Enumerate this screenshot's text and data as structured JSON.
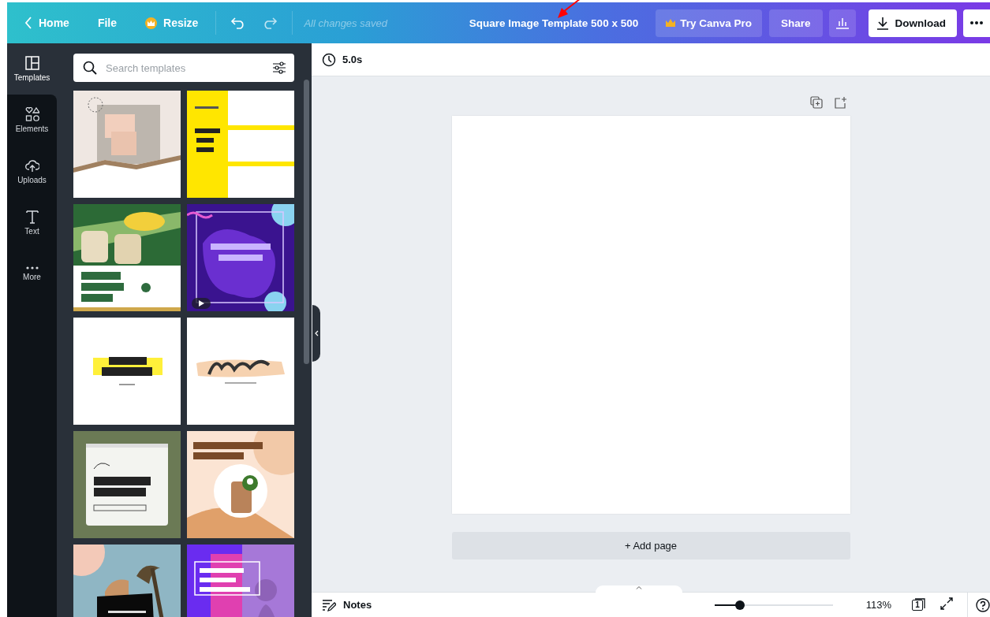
{
  "topbar": {
    "home": "Home",
    "file": "File",
    "resize": "Resize",
    "save_status": "All changes saved",
    "title": "Square Image Template 500 x 500",
    "pro_button": "Try Canva Pro",
    "share": "Share",
    "download": "Download"
  },
  "rail": [
    {
      "kind": "templates",
      "label": "Templates",
      "selected": true
    },
    {
      "kind": "elements",
      "label": "Elements",
      "selected": false
    },
    {
      "kind": "uploads",
      "label": "Uploads",
      "selected": false
    },
    {
      "kind": "text",
      "label": "Text",
      "selected": false
    },
    {
      "kind": "more",
      "label": "More",
      "selected": false
    }
  ],
  "search": {
    "placeholder": "Search templates"
  },
  "templates": [
    {
      "kind": "picture",
      "video": false
    },
    {
      "kind": "picture",
      "video": false
    },
    {
      "kind": "picture",
      "video": false
    },
    {
      "kind": "picture",
      "video": true
    },
    {
      "kind": "picture",
      "video": false
    },
    {
      "kind": "picture",
      "video": false
    },
    {
      "kind": "picture",
      "video": false
    },
    {
      "kind": "picture",
      "video": false
    },
    {
      "kind": "picture",
      "video": false
    },
    {
      "kind": "picture",
      "video": false
    }
  ],
  "toolbar": {
    "duration": "5.0s"
  },
  "add_page": "+ Add page",
  "footer": {
    "notes": "Notes",
    "zoom_slider": {
      "level": 0.21
    },
    "zoom": "113%",
    "page_count": "1"
  }
}
